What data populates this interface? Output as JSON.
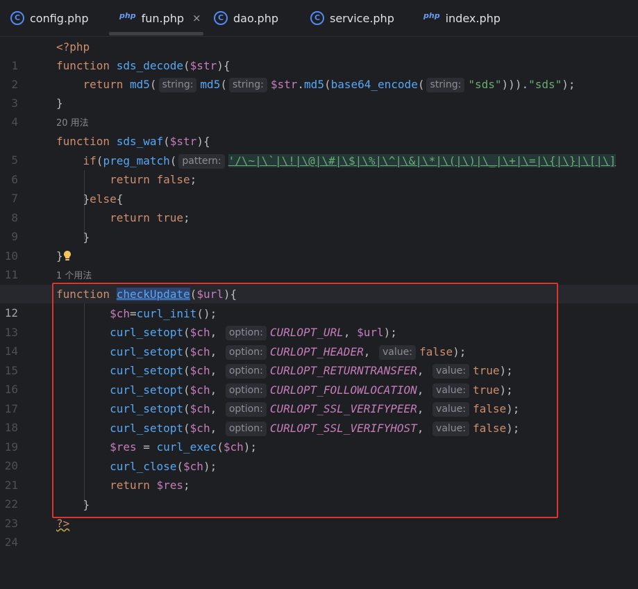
{
  "tabs": [
    {
      "label": "config.php",
      "icon": "class-file-icon",
      "active": false
    },
    {
      "label": "fun.php",
      "icon": "php-file-icon",
      "active": true,
      "close": "×"
    },
    {
      "label": "dao.php",
      "icon": "class-file-icon",
      "active": false
    },
    {
      "label": "service.php",
      "icon": "class-file-icon",
      "active": false
    },
    {
      "label": "index.php",
      "icon": "php-file-icon",
      "active": false
    }
  ],
  "icons": {
    "class": "C",
    "php": "php"
  },
  "lines": {
    "n1": "1",
    "n2": "2",
    "n3": "3",
    "n4": "4",
    "n5": "5",
    "n6": "6",
    "n7": "7",
    "n8": "8",
    "n9": "9",
    "n10": "10",
    "n11": "11",
    "n12": "12",
    "n13": "13",
    "n14": "14",
    "n15": "15",
    "n16": "16",
    "n17": "17",
    "n18": "18",
    "n19": "19",
    "n20": "20",
    "n21": "21",
    "n22": "22",
    "n23": "23",
    "n24": "24"
  },
  "hints": {
    "usage_20": "20 用法",
    "usage_1": "1 个用法",
    "string": "string:",
    "pattern": "pattern:",
    "option": "option:",
    "value": "value:"
  },
  "code": {
    "php_open": "<?php",
    "kw_function": "function",
    "kw_return": "return",
    "kw_if": "if",
    "kw_else": "else",
    "kw_false": "false",
    "kw_true": "true",
    "fn_sds_decode": "sds_decode",
    "fn_sds_waf": "sds_waf",
    "fn_checkUpdate": "checkUpdate",
    "fn_md5": "md5",
    "fn_base64": "base64_encode",
    "fn_preg_match": "preg_match",
    "fn_curl_init": "curl_init",
    "fn_curl_setopt": "curl_setopt",
    "fn_curl_exec": "curl_exec",
    "fn_curl_close": "curl_close",
    "var_str": "$str",
    "var_url": "$url",
    "var_ch": "$ch",
    "var_res": "$res",
    "str_sds": "\"sds\"",
    "regex": "'/\\~|\\`|\\!|\\@|\\#|\\$|\\%|\\^|\\&|\\*|\\(|\\)|\\_|\\+|\\=|\\{|\\}|\\[|\\]",
    "c_url": "CURLOPT_URL",
    "c_header": "CURLOPT_HEADER",
    "c_return": "CURLOPT_RETURNTRANSFER",
    "c_follow": "CURLOPT_FOLLOWLOCATION",
    "c_peer": "CURLOPT_SSL_VERIFYPEER",
    "c_host": "CURLOPT_SSL_VERIFYHOST",
    "php_close": "?>"
  },
  "colors": {
    "highlight_box": "#e0342a",
    "keyword": "#cf8e6d",
    "function": "#56a8f5",
    "variable": "#c77dbb",
    "string": "#6aab73"
  }
}
